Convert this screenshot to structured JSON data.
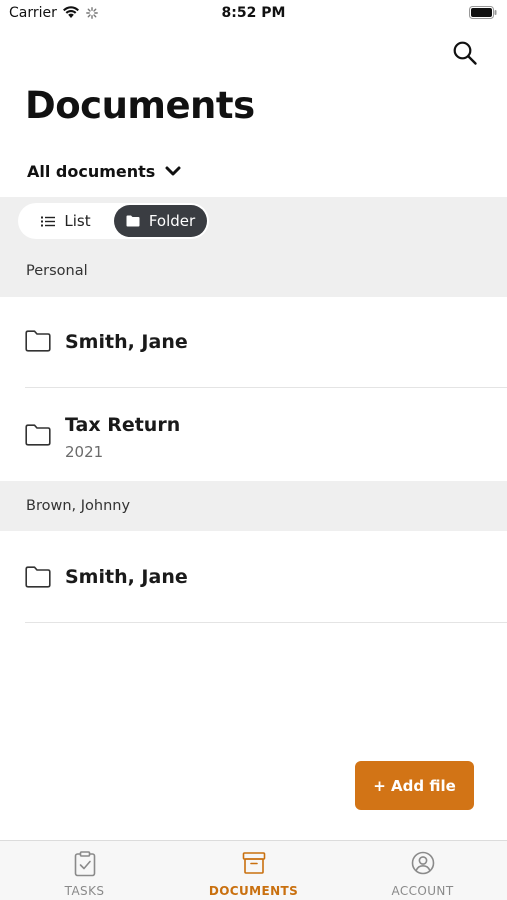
{
  "status_bar": {
    "carrier": "Carrier",
    "time": "8:52 PM"
  },
  "header": {
    "title": "Documents",
    "search_icon": "search-icon"
  },
  "filter": {
    "label": "All documents",
    "icon": "chevron-down-icon"
  },
  "view_toggle": {
    "options": [
      {
        "label": "List",
        "icon": "list-icon",
        "selected": false
      },
      {
        "label": "Folder",
        "icon": "folder-icon",
        "selected": true
      }
    ]
  },
  "sections": [
    {
      "header": "Personal",
      "items": [
        {
          "title": "Smith, Jane",
          "subtitle": ""
        },
        {
          "title": "Tax Return",
          "subtitle": "2021"
        }
      ]
    },
    {
      "header": "Brown, Johnny",
      "items": [
        {
          "title": "Smith, Jane",
          "subtitle": ""
        }
      ]
    }
  ],
  "add_file": {
    "label": "+ Add file"
  },
  "tab_bar": {
    "tabs": [
      {
        "label": "TASKS",
        "icon": "clipboard-check-icon",
        "active": false
      },
      {
        "label": "DOCUMENTS",
        "icon": "archive-box-icon",
        "active": true
      },
      {
        "label": "ACCOUNT",
        "icon": "user-circle-icon",
        "active": false
      }
    ]
  },
  "colors": {
    "accent": "#d27416",
    "segment_selected": "#3a3d42",
    "section_background": "#efefef",
    "tab_inactive": "#8a8a8a"
  }
}
